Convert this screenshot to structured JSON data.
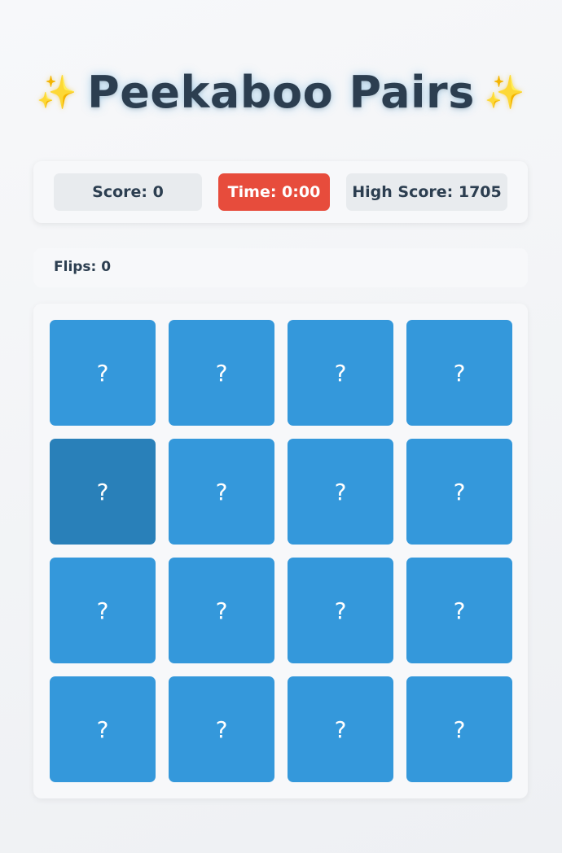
{
  "header": {
    "title": "Peekaboo Pairs",
    "sparkle_left": "✨",
    "sparkle_right": "✨"
  },
  "stats": {
    "score": "Score: 0",
    "time": "Time: 0:00",
    "high_score": "High Score: 1705"
  },
  "flips": "Flips: 0",
  "cards": [
    {
      "face": "?",
      "state": "hidden"
    },
    {
      "face": "?",
      "state": "hidden"
    },
    {
      "face": "?",
      "state": "hidden"
    },
    {
      "face": "?",
      "state": "hidden"
    },
    {
      "face": "?",
      "state": "hovered"
    },
    {
      "face": "?",
      "state": "hidden"
    },
    {
      "face": "?",
      "state": "hidden"
    },
    {
      "face": "?",
      "state": "hidden"
    },
    {
      "face": "?",
      "state": "hidden"
    },
    {
      "face": "?",
      "state": "hidden"
    },
    {
      "face": "?",
      "state": "hidden"
    },
    {
      "face": "?",
      "state": "hidden"
    },
    {
      "face": "?",
      "state": "hidden"
    },
    {
      "face": "?",
      "state": "hidden"
    },
    {
      "face": "?",
      "state": "hidden"
    },
    {
      "face": "?",
      "state": "hidden"
    }
  ],
  "colors": {
    "card_back": "#3498db",
    "card_hover": "#2980b9",
    "timer_bg": "#e74c3c",
    "text": "#2c3e50"
  }
}
